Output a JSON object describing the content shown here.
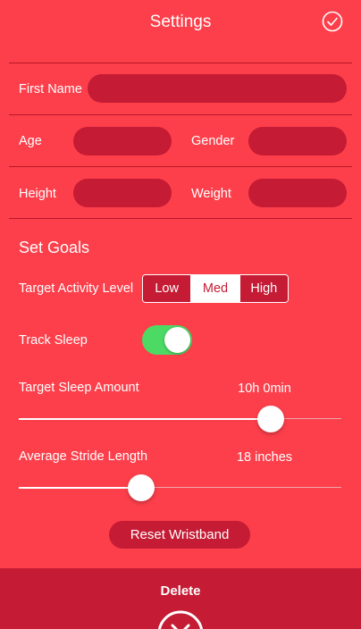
{
  "header": {
    "title": "Settings"
  },
  "profile": {
    "first_name_label": "First Name",
    "age_label": "Age",
    "gender_label": "Gender",
    "height_label": "Height",
    "weight_label": "Weight"
  },
  "goals": {
    "section_title": "Set Goals",
    "activity_label": "Target Activity Level",
    "activity_options": [
      "Low",
      "Med",
      "High"
    ],
    "activity_selected": "Med",
    "track_sleep_label": "Track Sleep",
    "track_sleep_on": true,
    "sleep_amount_label": "Target Sleep Amount",
    "sleep_amount_value": "10h 0min",
    "sleep_amount_fraction": 0.78,
    "stride_label": "Average Stride Length",
    "stride_value": "18 inches",
    "stride_fraction": 0.38,
    "reset_button": "Reset Wristband"
  },
  "footer": {
    "delete_label": "Delete"
  },
  "colors": {
    "background": "#fc3f4b",
    "field": "#c51b34",
    "toggle_on": "#4cd964"
  },
  "icons": {
    "confirm": "check-circle-icon",
    "delete": "close-circle-icon"
  }
}
